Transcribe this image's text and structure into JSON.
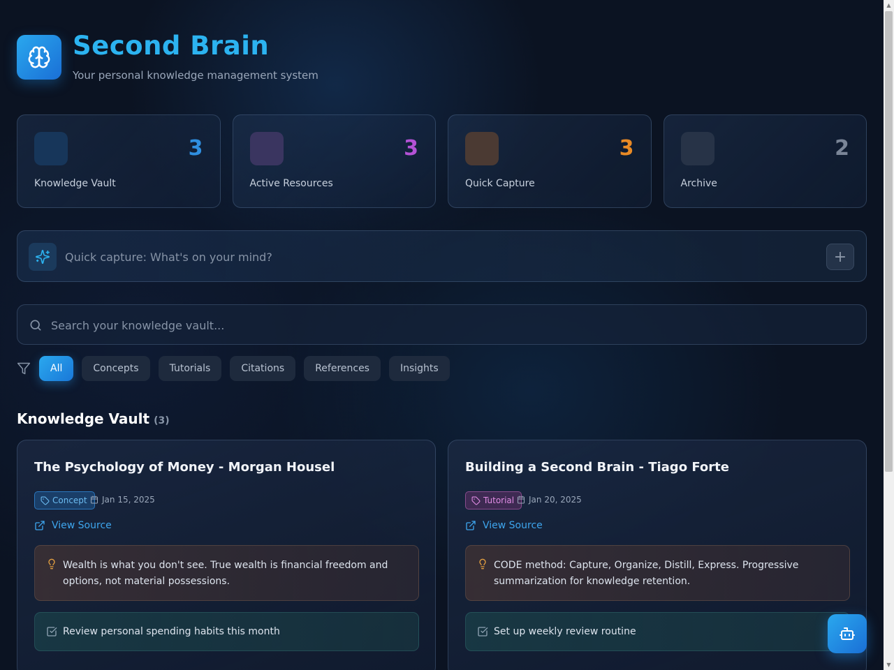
{
  "header": {
    "title": "Second Brain",
    "subtitle": "Your personal knowledge management system",
    "logo_icon": "brain-icon"
  },
  "stats": [
    {
      "label": "Knowledge Vault",
      "count": "3",
      "color": "#2f8fe0",
      "icon_bg": "#17365a"
    },
    {
      "label": "Active Resources",
      "count": "3",
      "color": "#b452d6",
      "icon_bg": "#3a3560"
    },
    {
      "label": "Quick Capture",
      "count": "3",
      "color": "#e98a25",
      "icon_bg": "#4b3a33"
    },
    {
      "label": "Archive",
      "count": "2",
      "color": "#7a8597",
      "icon_bg": "#273347"
    }
  ],
  "capture": {
    "placeholder": "Quick capture: What's on your mind?",
    "icon": "sparkles-icon",
    "add_label": "+"
  },
  "search": {
    "placeholder": "Search your knowledge vault..."
  },
  "filters": [
    "All",
    "Concepts",
    "Tutorials",
    "Citations",
    "References",
    "Insights"
  ],
  "active_filter": "All",
  "section": {
    "title": "Knowledge Vault",
    "count": "(3)"
  },
  "cards": [
    {
      "title": "The Psychology of Money - Morgan Housel",
      "tag": "Concept",
      "date": "Jan 15, 2025",
      "source_label": "View Source",
      "insight": "Wealth is what you don't see. True wealth is financial freedom and options, not material possessions.",
      "action": "Review personal spending habits this month"
    },
    {
      "title": "Building a Second Brain - Tiago Forte",
      "tag": "Tutorial",
      "date": "Jan 20, 2025",
      "source_label": "View Source",
      "insight": "CODE method: Capture, Organize, Distill, Express. Progressive summarization for knowledge retention.",
      "action": "Set up weekly review routine"
    }
  ],
  "colors": {
    "accent": "#2cb3f0",
    "background": "#0b1322"
  }
}
